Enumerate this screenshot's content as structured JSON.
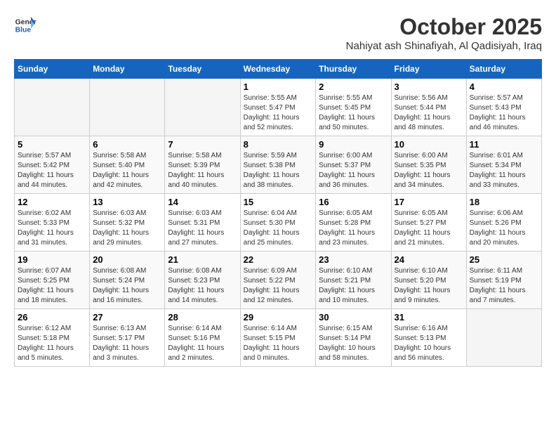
{
  "header": {
    "logo_line1": "General",
    "logo_line2": "Blue",
    "month": "October 2025",
    "location": "Nahiyat ash Shinafiyah, Al Qadisiyah, Iraq"
  },
  "weekdays": [
    "Sunday",
    "Monday",
    "Tuesday",
    "Wednesday",
    "Thursday",
    "Friday",
    "Saturday"
  ],
  "weeks": [
    [
      {
        "day": "",
        "info": ""
      },
      {
        "day": "",
        "info": ""
      },
      {
        "day": "",
        "info": ""
      },
      {
        "day": "1",
        "info": "Sunrise: 5:55 AM\nSunset: 5:47 PM\nDaylight: 11 hours\nand 52 minutes."
      },
      {
        "day": "2",
        "info": "Sunrise: 5:55 AM\nSunset: 5:45 PM\nDaylight: 11 hours\nand 50 minutes."
      },
      {
        "day": "3",
        "info": "Sunrise: 5:56 AM\nSunset: 5:44 PM\nDaylight: 11 hours\nand 48 minutes."
      },
      {
        "day": "4",
        "info": "Sunrise: 5:57 AM\nSunset: 5:43 PM\nDaylight: 11 hours\nand 46 minutes."
      }
    ],
    [
      {
        "day": "5",
        "info": "Sunrise: 5:57 AM\nSunset: 5:42 PM\nDaylight: 11 hours\nand 44 minutes."
      },
      {
        "day": "6",
        "info": "Sunrise: 5:58 AM\nSunset: 5:40 PM\nDaylight: 11 hours\nand 42 minutes."
      },
      {
        "day": "7",
        "info": "Sunrise: 5:58 AM\nSunset: 5:39 PM\nDaylight: 11 hours\nand 40 minutes."
      },
      {
        "day": "8",
        "info": "Sunrise: 5:59 AM\nSunset: 5:38 PM\nDaylight: 11 hours\nand 38 minutes."
      },
      {
        "day": "9",
        "info": "Sunrise: 6:00 AM\nSunset: 5:37 PM\nDaylight: 11 hours\nand 36 minutes."
      },
      {
        "day": "10",
        "info": "Sunrise: 6:00 AM\nSunset: 5:35 PM\nDaylight: 11 hours\nand 34 minutes."
      },
      {
        "day": "11",
        "info": "Sunrise: 6:01 AM\nSunset: 5:34 PM\nDaylight: 11 hours\nand 33 minutes."
      }
    ],
    [
      {
        "day": "12",
        "info": "Sunrise: 6:02 AM\nSunset: 5:33 PM\nDaylight: 11 hours\nand 31 minutes."
      },
      {
        "day": "13",
        "info": "Sunrise: 6:03 AM\nSunset: 5:32 PM\nDaylight: 11 hours\nand 29 minutes."
      },
      {
        "day": "14",
        "info": "Sunrise: 6:03 AM\nSunset: 5:31 PM\nDaylight: 11 hours\nand 27 minutes."
      },
      {
        "day": "15",
        "info": "Sunrise: 6:04 AM\nSunset: 5:30 PM\nDaylight: 11 hours\nand 25 minutes."
      },
      {
        "day": "16",
        "info": "Sunrise: 6:05 AM\nSunset: 5:28 PM\nDaylight: 11 hours\nand 23 minutes."
      },
      {
        "day": "17",
        "info": "Sunrise: 6:05 AM\nSunset: 5:27 PM\nDaylight: 11 hours\nand 21 minutes."
      },
      {
        "day": "18",
        "info": "Sunrise: 6:06 AM\nSunset: 5:26 PM\nDaylight: 11 hours\nand 20 minutes."
      }
    ],
    [
      {
        "day": "19",
        "info": "Sunrise: 6:07 AM\nSunset: 5:25 PM\nDaylight: 11 hours\nand 18 minutes."
      },
      {
        "day": "20",
        "info": "Sunrise: 6:08 AM\nSunset: 5:24 PM\nDaylight: 11 hours\nand 16 minutes."
      },
      {
        "day": "21",
        "info": "Sunrise: 6:08 AM\nSunset: 5:23 PM\nDaylight: 11 hours\nand 14 minutes."
      },
      {
        "day": "22",
        "info": "Sunrise: 6:09 AM\nSunset: 5:22 PM\nDaylight: 11 hours\nand 12 minutes."
      },
      {
        "day": "23",
        "info": "Sunrise: 6:10 AM\nSunset: 5:21 PM\nDaylight: 11 hours\nand 10 minutes."
      },
      {
        "day": "24",
        "info": "Sunrise: 6:10 AM\nSunset: 5:20 PM\nDaylight: 11 hours\nand 9 minutes."
      },
      {
        "day": "25",
        "info": "Sunrise: 6:11 AM\nSunset: 5:19 PM\nDaylight: 11 hours\nand 7 minutes."
      }
    ],
    [
      {
        "day": "26",
        "info": "Sunrise: 6:12 AM\nSunset: 5:18 PM\nDaylight: 11 hours\nand 5 minutes."
      },
      {
        "day": "27",
        "info": "Sunrise: 6:13 AM\nSunset: 5:17 PM\nDaylight: 11 hours\nand 3 minutes."
      },
      {
        "day": "28",
        "info": "Sunrise: 6:14 AM\nSunset: 5:16 PM\nDaylight: 11 hours\nand 2 minutes."
      },
      {
        "day": "29",
        "info": "Sunrise: 6:14 AM\nSunset: 5:15 PM\nDaylight: 11 hours\nand 0 minutes."
      },
      {
        "day": "30",
        "info": "Sunrise: 6:15 AM\nSunset: 5:14 PM\nDaylight: 10 hours\nand 58 minutes."
      },
      {
        "day": "31",
        "info": "Sunrise: 6:16 AM\nSunset: 5:13 PM\nDaylight: 10 hours\nand 56 minutes."
      },
      {
        "day": "",
        "info": ""
      }
    ]
  ]
}
